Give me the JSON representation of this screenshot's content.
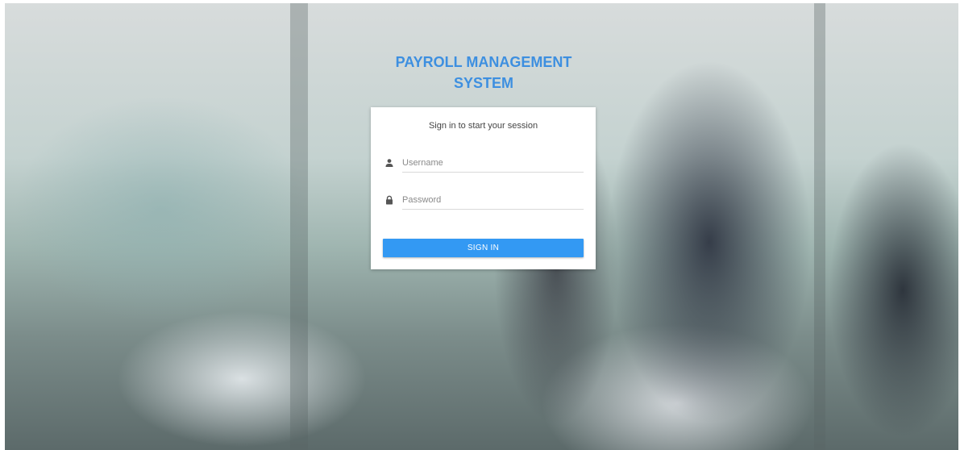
{
  "header": {
    "title_line1": "PAYROLL MANAGEMENT",
    "title_line2": "SYSTEM"
  },
  "login": {
    "subtitle": "Sign in to start your session",
    "username": {
      "placeholder": "Username",
      "value": "",
      "icon": "user-icon"
    },
    "password": {
      "placeholder": "Password",
      "value": "",
      "icon": "lock-icon"
    },
    "submit_label": "SIGN IN"
  },
  "colors": {
    "accent": "#3399f3",
    "title": "#3d8fe0"
  }
}
